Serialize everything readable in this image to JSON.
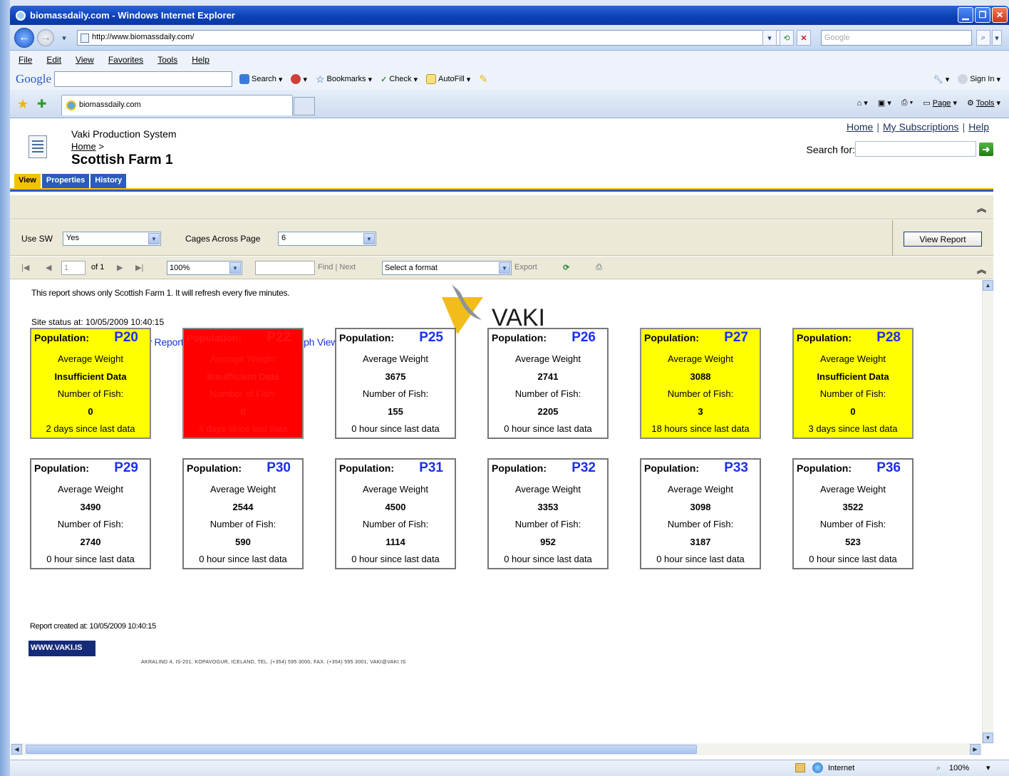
{
  "window": {
    "title": "biomassdaily.com - Windows Internet Explorer",
    "url": "http://www.biomassdaily.com/",
    "search_placeholder": "Google",
    "tab_title": "biomassdaily.com"
  },
  "menu": [
    "File",
    "Edit",
    "View",
    "Favorites",
    "Tools",
    "Help"
  ],
  "google_toolbar": {
    "logo": "Google",
    "search_label": "Search",
    "bookmarks_label": "Bookmarks",
    "check_label": "Check",
    "autofill_label": "AutoFill",
    "signin_label": "Sign In"
  },
  "command_bar": {
    "page_label": "Page",
    "tools_label": "Tools"
  },
  "sharepoint": {
    "site_title": "Vaki Production System",
    "breadcrumb_home": "Home",
    "breadcrumb_sep": ">",
    "page_title": "Scottish Farm 1",
    "top_links": [
      "Home",
      "My Subscriptions",
      "Help"
    ],
    "search_for_label": "Search for:",
    "tabs": [
      "View",
      "Properties",
      "History"
    ]
  },
  "params": {
    "use_sw_label": "Use SW",
    "use_sw_value": "Yes",
    "cages_label": "Cages Across Page",
    "cages_value": "6",
    "view_report_label": "View Report"
  },
  "report_toolbar": {
    "page_value": "1",
    "of_label": "of 1",
    "zoom_value": "100%",
    "find_label": "Find",
    "next_label": "Next",
    "format_value": "Select a format",
    "export_label": "Export"
  },
  "report": {
    "description": "This report shows only Scottish Farm 1. It will refresh every five minutes.",
    "site_status": "Site status at: 10/05/2009 10:40:15",
    "link_summary": "Click here for Site Summary Report",
    "link_graph": "Click here for Graph View (takes a while...)",
    "logo_text": "VAKI",
    "population_label": "Population:",
    "avg_weight_label": "Average Weight",
    "num_fish_label": "Number of Fish:",
    "created": "Report created at: 10/05/2009 10:40:15",
    "www": "WWW.VAKI.IS",
    "footer_address": "AKRALIND 4, IS-201, KOPAVOGUR, ICELAND, TEL. (+354) 595 3000, FAX. (+354) 595 3001, VAKI@VAKI.IS",
    "cages": [
      {
        "id": "P20",
        "weight": "Insufficient Data",
        "fish": "0",
        "since": "2 days since last data",
        "status": "yellow"
      },
      {
        "id": "P22",
        "weight": "Insufficient Data",
        "fish": "0",
        "since": "4 days since last data",
        "status": "red"
      },
      {
        "id": "P25",
        "weight": "3675",
        "fish": "155",
        "since": "0 hour since last data",
        "status": "white"
      },
      {
        "id": "P26",
        "weight": "2741",
        "fish": "2205",
        "since": "0 hour since last data",
        "status": "white"
      },
      {
        "id": "P27",
        "weight": "3088",
        "fish": "3",
        "since": "18 hours since last data",
        "status": "yellow"
      },
      {
        "id": "P28",
        "weight": "Insufficient Data",
        "fish": "0",
        "since": "3 days since last data",
        "status": "yellow"
      },
      {
        "id": "P29",
        "weight": "3490",
        "fish": "2740",
        "since": "0 hour since last data",
        "status": "white"
      },
      {
        "id": "P30",
        "weight": "2544",
        "fish": "590",
        "since": "0 hour since last data",
        "status": "white"
      },
      {
        "id": "P31",
        "weight": "4500",
        "fish": "1114",
        "since": "0 hour since last data",
        "status": "white"
      },
      {
        "id": "P32",
        "weight": "3353",
        "fish": "952",
        "since": "0 hour since last data",
        "status": "white"
      },
      {
        "id": "P33",
        "weight": "3098",
        "fish": "3187",
        "since": "0 hour since last data",
        "status": "white"
      },
      {
        "id": "P36",
        "weight": "3522",
        "fish": "523",
        "since": "0 hour since last data",
        "status": "white"
      }
    ]
  },
  "statusbar": {
    "zone": "Internet",
    "zoom": "100%"
  },
  "colors": {
    "stale_warning": "#ffff00",
    "stale_alert": "#ff0000",
    "cage_id": "#1a2ff0",
    "link": "#1a34d6"
  }
}
